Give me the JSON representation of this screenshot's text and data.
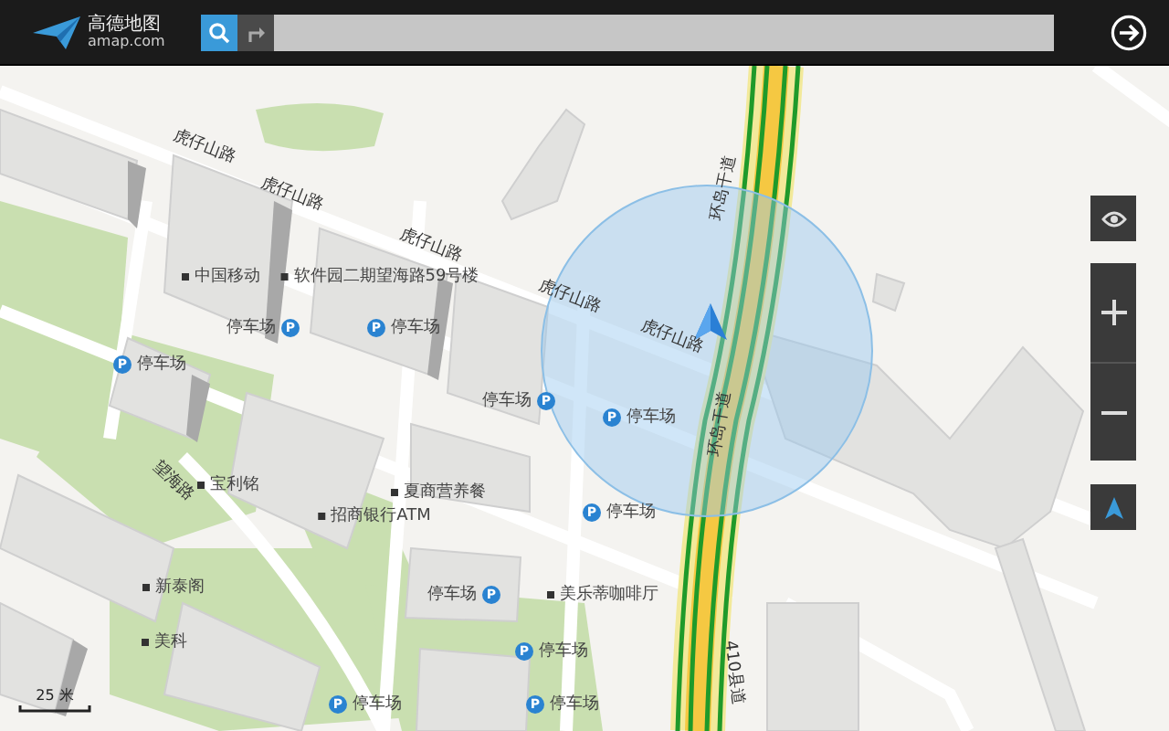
{
  "header": {
    "logo_title": "高德地图",
    "logo_subtitle": "amap.com"
  },
  "map": {
    "labels": [
      {
        "kind": "road",
        "text": "虎仔山路"
      },
      {
        "kind": "road",
        "text": "虎仔山路"
      },
      {
        "kind": "road",
        "text": "虎仔山路"
      },
      {
        "kind": "road",
        "text": "虎仔山路"
      },
      {
        "kind": "road",
        "text": "虎仔山路"
      },
      {
        "kind": "road",
        "text": "环岛干道"
      },
      {
        "kind": "road",
        "text": "环岛干道"
      },
      {
        "kind": "road",
        "text": "410县道"
      },
      {
        "kind": "road",
        "text": "望海路"
      },
      {
        "kind": "poi",
        "text": "中国移动"
      },
      {
        "kind": "poi",
        "text": "软件园二期望海路59号楼"
      },
      {
        "kind": "poi",
        "text": "宝利铭"
      },
      {
        "kind": "poi",
        "text": "夏商营养餐"
      },
      {
        "kind": "poi",
        "text": "招商银行ATM"
      },
      {
        "kind": "poi",
        "text": "新泰阁"
      },
      {
        "kind": "poi",
        "text": "美科"
      },
      {
        "kind": "poi",
        "text": "美乐蒂咖啡厅"
      },
      {
        "kind": "parking",
        "text": "停车场",
        "badge": "P"
      },
      {
        "kind": "parking",
        "text": "停车场",
        "badge": "P"
      },
      {
        "kind": "parking",
        "text": "停车场",
        "badge": "P"
      },
      {
        "kind": "parking",
        "text": "停车场",
        "badge": "P"
      },
      {
        "kind": "parking",
        "text": "停车场",
        "badge": "P"
      },
      {
        "kind": "parking",
        "text": "停车场",
        "badge": "P"
      },
      {
        "kind": "parking",
        "text": "停车场",
        "badge": "P"
      },
      {
        "kind": "parking",
        "text": "停车场",
        "badge": "P"
      },
      {
        "kind": "parking",
        "text": "停车场",
        "badge": "P"
      },
      {
        "kind": "parking",
        "text": "停车场",
        "badge": "P"
      }
    ],
    "scale": "25 米"
  }
}
